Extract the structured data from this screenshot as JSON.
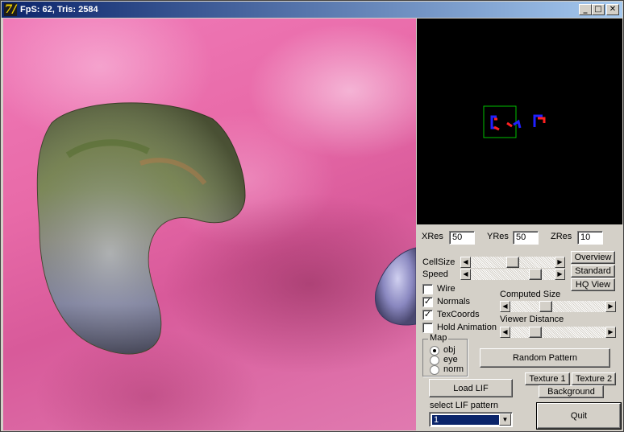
{
  "window": {
    "title": "FpS: 62, Tris: 2584",
    "app_icon": "7/",
    "minimize_glyph": "_",
    "maximize_glyph": "□",
    "close_glyph": "✕"
  },
  "resolution": {
    "xres_label": "XRes",
    "xres_value": "50",
    "yres_label": "YRes",
    "yres_value": "50",
    "zres_label": "ZRes",
    "zres_value": "10"
  },
  "sliders": {
    "cellsize_label": "CellSize",
    "speed_label": "Speed",
    "computed_size_label": "Computed Size",
    "viewer_distance_label": "Viewer Distance",
    "cellsize_level": 0.5,
    "speed_level": 0.82,
    "computed_size_level": 0.35,
    "viewer_distance_level": 0.23
  },
  "view_buttons": {
    "overview": "Overview",
    "standard": "Standard",
    "hq_view": "HQ View"
  },
  "checkboxes": [
    {
      "label": "Wire",
      "checked": false
    },
    {
      "label": "Normals",
      "checked": true
    },
    {
      "label": "TexCoords",
      "checked": true
    },
    {
      "label": "Hold Animation",
      "checked": false
    }
  ],
  "check_glyph": "✓",
  "map_group": {
    "title": "Map",
    "options": [
      {
        "label": "obj",
        "selected": true
      },
      {
        "label": "eye",
        "selected": false
      },
      {
        "label": "norm",
        "selected": false
      }
    ]
  },
  "buttons": {
    "random_pattern": "Random Pattern",
    "texture1": "Texture 1",
    "texture2": "Texture 2",
    "background": "Background",
    "load_lif": "Load LIF",
    "quit": "Quit"
  },
  "lif_select": {
    "label": "select LIF pattern",
    "value": "1"
  },
  "scroll_left_glyph": "◀",
  "scroll_right_glyph": "▶",
  "dropdown_glyph": "▼",
  "colors": {
    "titlebar_start": "#0a246a",
    "titlebar_end": "#a6caf0",
    "face": "#d4d0c8",
    "overview_bg": "#000000",
    "overview_box": "#00c000",
    "pattern_blue": "#2020ff",
    "pattern_red": "#ff2020"
  }
}
